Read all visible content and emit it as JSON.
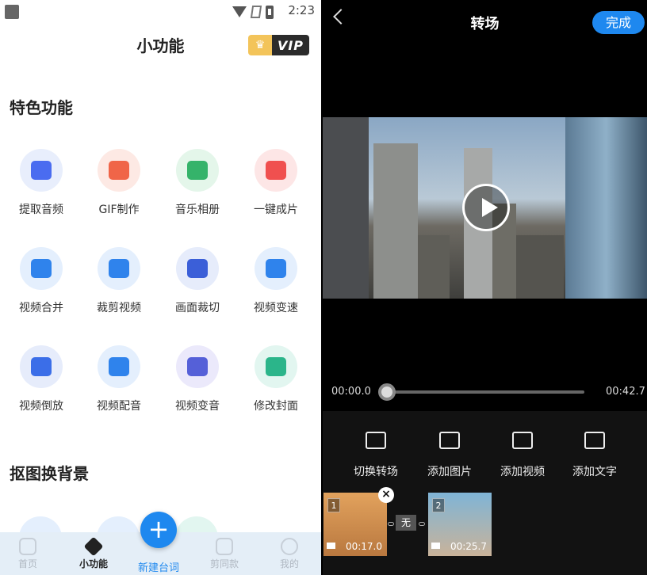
{
  "status_bar": {
    "time": "2:23"
  },
  "left": {
    "title": "小功能",
    "vip_label": "VIP",
    "section_featured": "特色功能",
    "section_cutout": "抠图换背景",
    "tools": [
      {
        "label": "提取音频",
        "bg": "#e8eefc",
        "fg": "#4a6cf0",
        "icon": "audio-extract-icon"
      },
      {
        "label": "GIF制作",
        "bg": "#fde9e4",
        "fg": "#f06548",
        "icon": "gif-icon"
      },
      {
        "label": "音乐相册",
        "bg": "#e4f6ea",
        "fg": "#35b36a",
        "icon": "music-album-icon"
      },
      {
        "label": "一键成片",
        "bg": "#fde6e6",
        "fg": "#f0504f",
        "icon": "camera-icon"
      },
      {
        "label": "视频合并",
        "bg": "#e4effd",
        "fg": "#2f83ec",
        "icon": "merge-icon"
      },
      {
        "label": "裁剪视频",
        "bg": "#e4effd",
        "fg": "#2f83ec",
        "icon": "scissors-icon"
      },
      {
        "label": "画面裁切",
        "bg": "#e6ecfb",
        "fg": "#3b5fd8",
        "icon": "crop-icon"
      },
      {
        "label": "视频变速",
        "bg": "#e4effd",
        "fg": "#2f83ec",
        "icon": "speed-icon"
      },
      {
        "label": "视频倒放",
        "bg": "#e6ecfb",
        "fg": "#3b6ee8",
        "icon": "reverse-icon"
      },
      {
        "label": "视频配音",
        "bg": "#e4effd",
        "fg": "#2f83ec",
        "icon": "dubbing-icon"
      },
      {
        "label": "视频变音",
        "bg": "#ebe9fb",
        "fg": "#5560d8",
        "icon": "voice-change-icon"
      },
      {
        "label": "修改封面",
        "bg": "#e2f6f0",
        "fg": "#2bb58a",
        "icon": "cover-icon"
      }
    ],
    "nav": {
      "home": "首页",
      "tools": "小功能",
      "new": "新建台词",
      "same": "剪同款",
      "mine": "我的"
    }
  },
  "right": {
    "title": "转场",
    "done_label": "完成",
    "time_start": "00:00.0",
    "time_end": "00:42.7",
    "progress": 0,
    "toolbar": {
      "switch_transition": "切换转场",
      "add_image": "添加图片",
      "add_video": "添加视频",
      "add_text": "添加文字"
    },
    "clips": [
      {
        "num": "1",
        "duration": "00:17.0"
      },
      {
        "num": "2",
        "duration": "00:25.7"
      }
    ],
    "transition_label": "无"
  }
}
